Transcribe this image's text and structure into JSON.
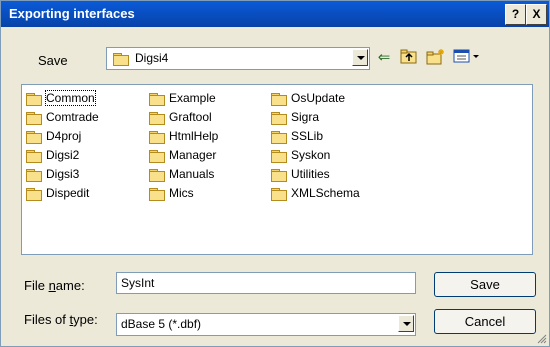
{
  "window": {
    "title": "Exporting interfaces",
    "help_label": "?",
    "close_label": "X"
  },
  "save_in": {
    "label": "Save",
    "folder": "Digsi4"
  },
  "toolbar": {
    "back_icon": "back-arrow-icon",
    "up_icon": "up-folder-icon",
    "new_folder_icon": "new-folder-icon",
    "views_icon": "views-menu-icon"
  },
  "folders": [
    [
      "Common",
      "Comtrade",
      "D4proj",
      "Digsi2",
      "Digsi3",
      "Dispedit"
    ],
    [
      "Example",
      "Graftool",
      "HtmlHelp",
      "Manager",
      "Manuals",
      "Mics"
    ],
    [
      "OsUpdate",
      "Sigra",
      "SSLib",
      "Syskon",
      "Utilities",
      "XMLSchema"
    ]
  ],
  "file_name": {
    "label_pre": "File ",
    "label_u": "n",
    "label_post": "ame:",
    "value": "SysInt"
  },
  "file_type": {
    "label_pre": "Files of ",
    "label_u": "t",
    "label_post": "ype:",
    "value": "dBase 5 (*.dbf)"
  },
  "buttons": {
    "save": "Save",
    "cancel": "Cancel"
  }
}
